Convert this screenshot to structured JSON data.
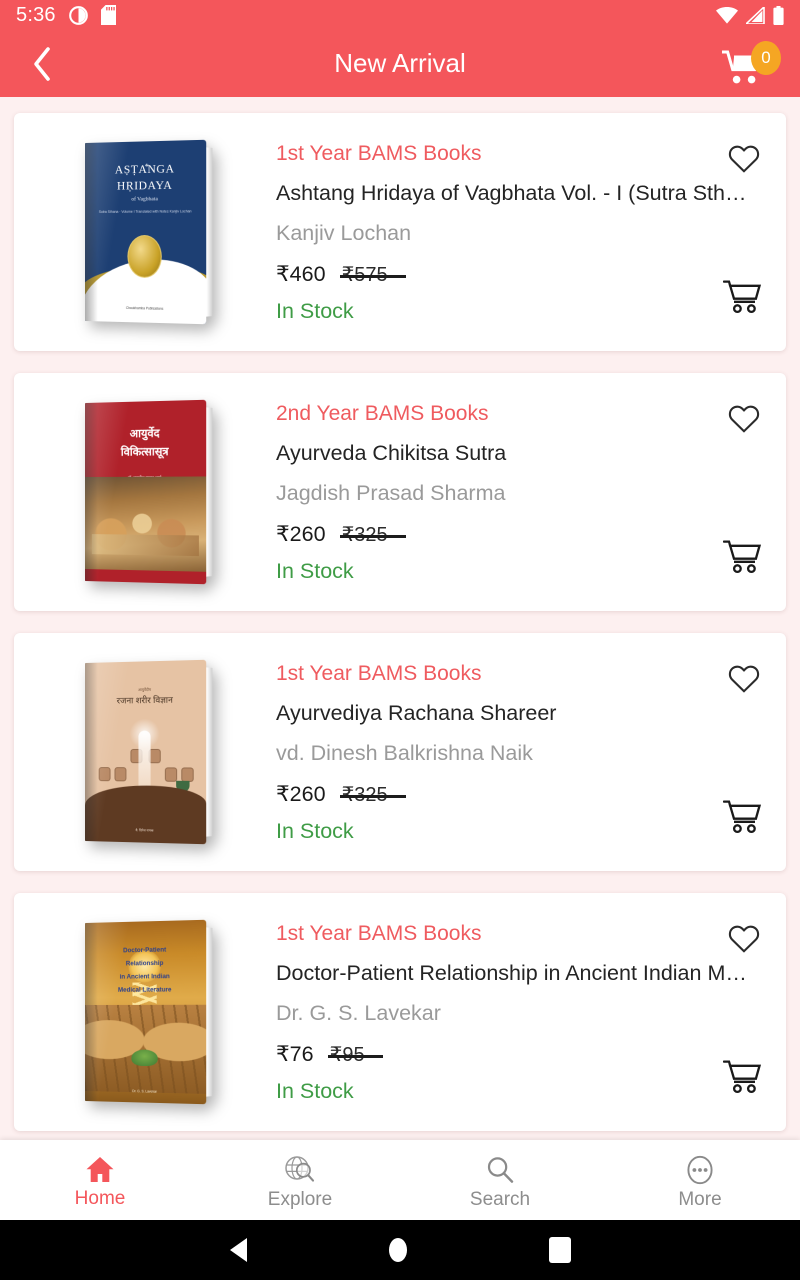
{
  "status_bar": {
    "time": "5:36",
    "icons": [
      "dnd-circle-icon",
      "sd-card-icon",
      "wifi-icon",
      "cellular-signal-icon",
      "battery-icon"
    ]
  },
  "app_bar": {
    "back_icon": "chevron-left-icon",
    "title": "New Arrival",
    "cart_icon": "shopping-cart-icon",
    "cart_count": "0",
    "badge_color": "#f5a623",
    "bar_color": "#f4565b"
  },
  "theme": {
    "accent": "#f4565b",
    "category_text": "#ef5b5f",
    "stock_text": "#3f9c46",
    "author_text": "#9a9a9a",
    "page_bg": "#fdf0f0",
    "card_bg": "#ffffff"
  },
  "products": [
    {
      "category": "1st Year BAMS Books",
      "title": "Ashtang Hridaya of Vagbhata Vol. - I (Sutra Sthan…",
      "author": "Kanjiv Lochan",
      "price": "₹460",
      "mrp": "₹575",
      "stock": "In Stock",
      "cover": {
        "style": "navy",
        "line1": "AṢṬA̐NGA",
        "line2": "HṚIDAYA",
        "line3": "of Vagbhata",
        "line4": "Sutra Sthana · Volume I\nTranslated with Notes\nKanjiv Lochan",
        "footer": "Chaukhamba Publications"
      },
      "fav_icon": "heart-outline-icon",
      "cart_icon": "add-to-cart-icon"
    },
    {
      "category": "2nd Year BAMS Books",
      "title": "Ayurveda Chikitsa Sutra",
      "author": "Jagdish Prasad Sharma",
      "price": "₹260",
      "mrp": "₹325",
      "stock": "In Stock",
      "cover": {
        "style": "crimson",
        "line1": "आयुर्वेद",
        "line2": "विकित्सासूत्र",
        "line3": "डॉ. जगदीश प्रसाद शर्मा",
        "footer": ""
      },
      "fav_icon": "heart-outline-icon",
      "cart_icon": "add-to-cart-icon"
    },
    {
      "category": "1st Year BAMS Books",
      "title": "Ayurvediya Rachana Shareer",
      "author": "vd. Dinesh Balkrishna Naik",
      "price": "₹260",
      "mrp": "₹325",
      "stock": "In Stock",
      "cover": {
        "style": "tan",
        "line1": "आयुर्वेदीय",
        "line2": "रजना शरीर विज्ञान",
        "footer": "वै. दिनेश नायक"
      },
      "fav_icon": "heart-outline-icon",
      "cart_icon": "add-to-cart-icon"
    },
    {
      "category": "1st Year BAMS Books",
      "title": "Doctor-Patient Relationship in Ancient Indian Me…",
      "author": "Dr. G. S. Lavekar",
      "price": "₹76",
      "mrp": "₹95",
      "stock": "In Stock",
      "cover": {
        "style": "gold",
        "line1": "Doctor-Patient\nRelationship\nin Ancient Indian\nMedical Literature",
        "footer": "Dr. G. S. Lavekar"
      },
      "fav_icon": "heart-outline-icon",
      "cart_icon": "add-to-cart-icon"
    }
  ],
  "tab_bar": {
    "tabs": [
      {
        "label": "Home",
        "icon": "home-icon",
        "active": true
      },
      {
        "label": "Explore",
        "icon": "globe-search-icon",
        "active": false
      },
      {
        "label": "Search",
        "icon": "search-icon",
        "active": false
      },
      {
        "label": "More",
        "icon": "more-dots-icon",
        "active": false
      }
    ]
  },
  "android_nav": {
    "back": "nav-back-icon",
    "home": "nav-home-icon",
    "recents": "nav-recents-icon"
  }
}
